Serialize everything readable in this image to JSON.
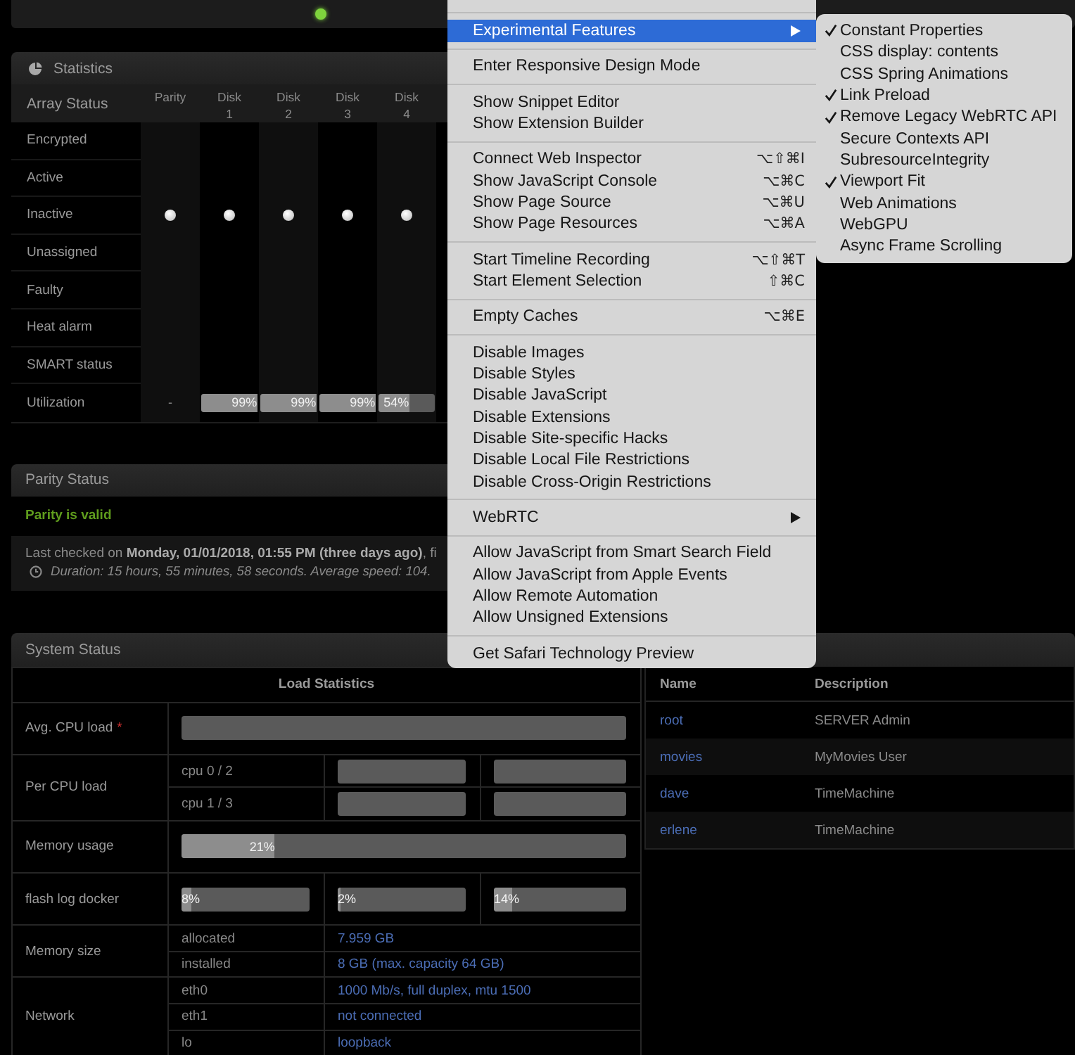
{
  "top_panel": {
    "indicator": {
      "on": true
    }
  },
  "statistics": {
    "title": "Statistics",
    "corner_label": "Array Status",
    "disks": [
      {
        "name": "Parity",
        "utilization": {
          "text": "-"
        }
      },
      {
        "name": "Disk",
        "number": "1",
        "utilization": {
          "level": 0.99,
          "text": "99%"
        }
      },
      {
        "name": "Disk",
        "number": "2",
        "utilization": {
          "level": 0.99,
          "text": "99%"
        }
      },
      {
        "name": "Disk",
        "number": "3",
        "utilization": {
          "level": 0.99,
          "text": "99%"
        }
      },
      {
        "name": "Disk",
        "number": "4",
        "utilization": {
          "level": 0.54,
          "text": "54%"
        }
      }
    ],
    "rows": [
      {
        "label": "Encrypted",
        "kind": "status",
        "dots": [
          false,
          false,
          false,
          false,
          false
        ]
      },
      {
        "label": "Active",
        "kind": "status",
        "dots": [
          false,
          false,
          false,
          false,
          false
        ]
      },
      {
        "label": "Inactive",
        "kind": "status",
        "dots": [
          true,
          true,
          true,
          true,
          true
        ]
      },
      {
        "label": "Unassigned",
        "kind": "status",
        "dots": [
          false,
          false,
          false,
          false,
          false
        ]
      },
      {
        "label": "Faulty",
        "kind": "status",
        "dots": [
          false,
          false,
          false,
          false,
          false
        ]
      },
      {
        "label": "Heat alarm",
        "kind": "status",
        "dots": [
          false,
          false,
          false,
          false,
          false
        ]
      },
      {
        "label": "SMART status",
        "kind": "status",
        "dots": [
          false,
          false,
          false,
          false,
          false
        ]
      },
      {
        "label": "Utilization",
        "kind": "utilization"
      }
    ]
  },
  "parity": {
    "title": "Parity Status",
    "status": "Parity is valid",
    "valid": true,
    "last_checked": "Last checked on **Monday, 01/01/2018, 01:55 PM (three days ago)**, fi",
    "duration": "Duration: 15 hours, 55 minutes, 58 seconds. Average speed: 104."
  },
  "system": {
    "title": "System Status",
    "table_title": "Load Statistics",
    "rows": [
      {
        "kind": "bar",
        "label": "Avg. CPU load",
        "note_mark": "*",
        "bars": [
          {
            "kind": "empty"
          }
        ]
      },
      {
        "kind": "sub_bars",
        "label": "Per CPU load",
        "lines": [
          {
            "name": "cpu 0 / 2",
            "bars": [
              {
                "kind": "empty"
              },
              {
                "kind": "empty"
              }
            ]
          },
          {
            "name": "cpu 1 / 3",
            "bars": [
              {
                "kind": "empty"
              },
              {
                "kind": "empty"
              }
            ]
          }
        ]
      },
      {
        "kind": "bar",
        "label": "Memory usage",
        "bars": [
          {
            "kind": "meter",
            "level": 0.21,
            "text": "21%"
          }
        ]
      },
      {
        "kind": "bar",
        "label": "flash log docker",
        "bars": [
          {
            "kind": "meter",
            "level": 0.08,
            "text": "8%"
          },
          {
            "kind": "meter",
            "level": 0.02,
            "text": "2%"
          },
          {
            "kind": "meter",
            "level": 0.14,
            "text": "14%"
          }
        ]
      },
      {
        "kind": "info",
        "label": "Memory size",
        "lines": [
          {
            "name": "allocated",
            "value": "7.959 GB"
          },
          {
            "name": "installed",
            "value": "8 GB (max. capacity 64 GB)"
          }
        ]
      },
      {
        "kind": "info",
        "label": "Network",
        "lines": [
          {
            "name": "eth0",
            "value": "1000 Mb/s, full duplex, mtu 1500"
          },
          {
            "name": "eth1",
            "value": "not connected"
          },
          {
            "name": "lo",
            "value": "loopback"
          }
        ]
      }
    ]
  },
  "users": {
    "columns": [
      "Name",
      "Description"
    ],
    "rows": [
      {
        "name": "root",
        "description": "SERVER Admin"
      },
      {
        "name": "movies",
        "description": "MyMovies User"
      },
      {
        "name": "dave",
        "description": "TimeMachine"
      },
      {
        "name": "erlene",
        "description": "TimeMachine"
      }
    ]
  },
  "menu": {
    "sections": [
      {
        "items": [
          {
            "label": "Experimental Features",
            "submenu": true,
            "selected": true
          }
        ]
      },
      {
        "items": [
          {
            "label": "Enter Responsive Design Mode",
            "submenu": false,
            "selected": false
          }
        ]
      },
      {
        "items": [
          {
            "label": "Show Snippet Editor",
            "submenu": false,
            "selected": false
          },
          {
            "label": "Show Extension Builder",
            "submenu": false,
            "selected": false
          }
        ]
      },
      {
        "items": [
          {
            "label": "Connect Web Inspector",
            "shortcut": "⌥⇧⌘I",
            "submenu": false,
            "selected": false
          },
          {
            "label": "Show JavaScript Console",
            "shortcut": "⌥⌘C",
            "submenu": false,
            "selected": false
          },
          {
            "label": "Show Page Source",
            "shortcut": "⌥⌘U",
            "submenu": false,
            "selected": false
          },
          {
            "label": "Show Page Resources",
            "shortcut": "⌥⌘A",
            "submenu": false,
            "selected": false
          }
        ]
      },
      {
        "items": [
          {
            "label": "Start Timeline Recording",
            "shortcut": "⌥⇧⌘T",
            "submenu": false,
            "selected": false
          },
          {
            "label": "Start Element Selection",
            "shortcut": "⇧⌘C",
            "submenu": false,
            "selected": false
          }
        ]
      },
      {
        "items": [
          {
            "label": "Empty Caches",
            "shortcut": "⌥⌘E",
            "submenu": false,
            "selected": false
          }
        ]
      },
      {
        "items": [
          {
            "label": "Disable Images",
            "submenu": false,
            "selected": false
          },
          {
            "label": "Disable Styles",
            "submenu": false,
            "selected": false
          },
          {
            "label": "Disable JavaScript",
            "submenu": false,
            "selected": false
          },
          {
            "label": "Disable Extensions",
            "submenu": false,
            "selected": false
          },
          {
            "label": "Disable Site-specific Hacks",
            "submenu": false,
            "selected": false
          },
          {
            "label": "Disable Local File Restrictions",
            "submenu": false,
            "selected": false
          },
          {
            "label": "Disable Cross-Origin Restrictions",
            "submenu": false,
            "selected": false
          }
        ]
      },
      {
        "items": [
          {
            "label": "WebRTC",
            "submenu": true,
            "selected": false
          }
        ]
      },
      {
        "items": [
          {
            "label": "Allow JavaScript from Smart Search Field",
            "submenu": false,
            "selected": false
          },
          {
            "label": "Allow JavaScript from Apple Events",
            "submenu": false,
            "selected": false
          },
          {
            "label": "Allow Remote Automation",
            "submenu": false,
            "selected": false
          },
          {
            "label": "Allow Unsigned Extensions",
            "submenu": false,
            "selected": false
          }
        ]
      },
      {
        "items": [
          {
            "label": "Get Safari Technology Preview",
            "submenu": false,
            "selected": false
          }
        ]
      }
    ]
  },
  "flyout": {
    "items": [
      {
        "label": "Constant Properties",
        "checked": true
      },
      {
        "label": "CSS display: contents",
        "checked": false
      },
      {
        "label": "CSS Spring Animations",
        "checked": false
      },
      {
        "label": "Link Preload",
        "checked": true
      },
      {
        "label": "Remove Legacy WebRTC API",
        "checked": true
      },
      {
        "label": "Secure Contexts API",
        "checked": false
      },
      {
        "label": "SubresourceIntegrity",
        "checked": false
      },
      {
        "label": "Viewport Fit",
        "checked": true
      },
      {
        "label": "Web Animations",
        "checked": false
      },
      {
        "label": "WebGPU",
        "checked": false
      },
      {
        "label": "Async Frame Scrolling",
        "checked": false
      }
    ]
  }
}
